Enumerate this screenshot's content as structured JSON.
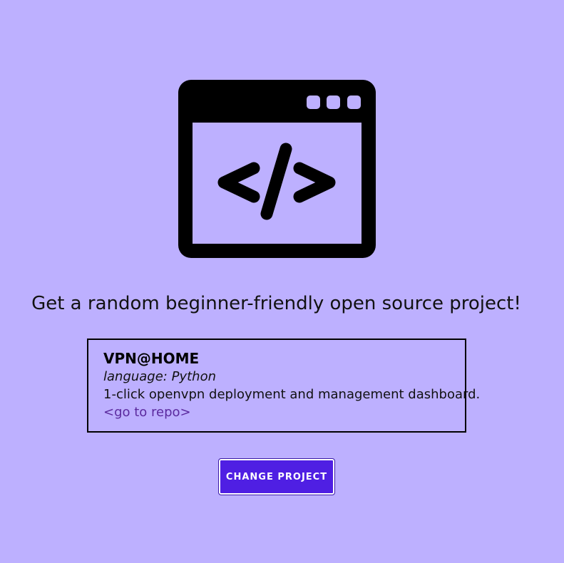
{
  "logo": {
    "icon": "code-window-icon"
  },
  "header": {
    "tagline": "Get a random beginner-friendly open source project!"
  },
  "project": {
    "name": "VPN@HOME",
    "language": "language: Python",
    "description": "1-click openvpn deployment and management dashboard.",
    "link_label": "<go to repo>"
  },
  "actions": {
    "change_label": "CHANGE PROJECT"
  },
  "colors": {
    "background": "#bdb0ff",
    "button": "#4f1fe3",
    "link": "#5b2a9e"
  }
}
